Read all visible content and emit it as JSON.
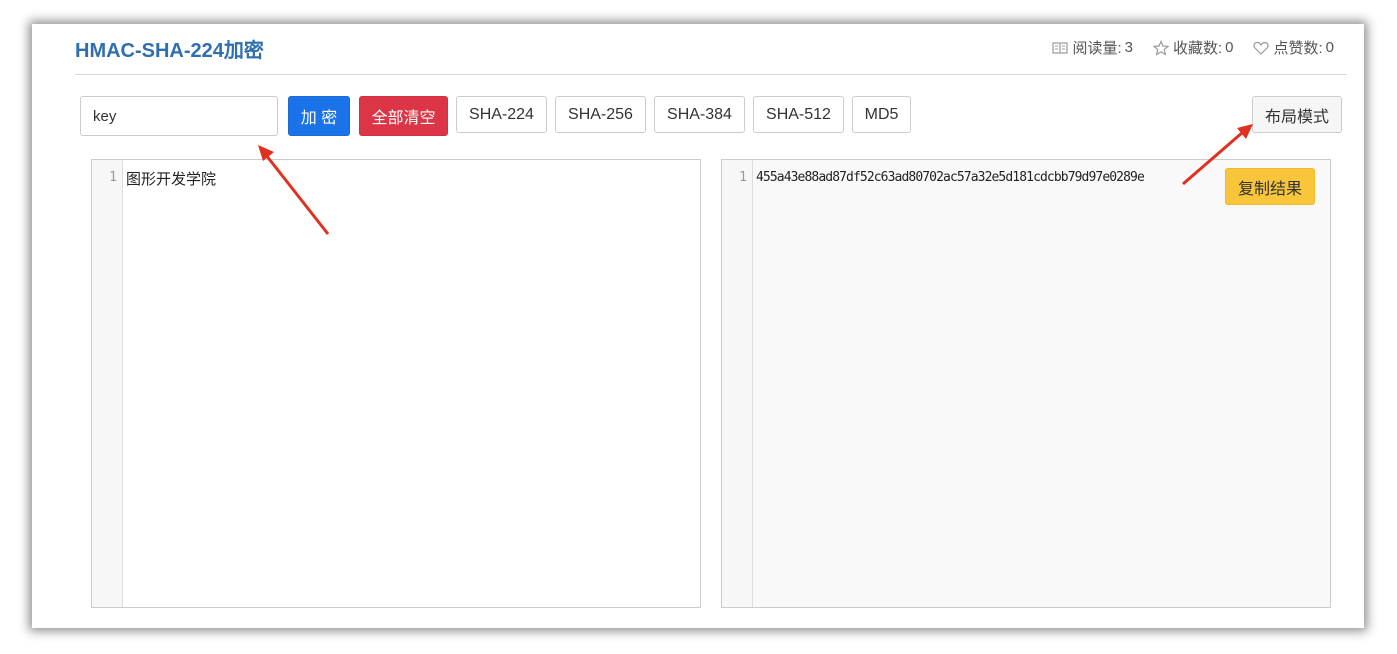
{
  "page": {
    "title": "HMAC-SHA-224加密",
    "stats": {
      "read_label": "阅读量:",
      "read_value": "3",
      "fav_label": "收藏数:",
      "fav_value": "0",
      "like_label": "点赞数:",
      "like_value": "0"
    }
  },
  "toolbar": {
    "key_value": "key",
    "encrypt_label": "加 密",
    "clear_label": "全部清空",
    "algorithms": [
      "SHA-224",
      "SHA-256",
      "SHA-384",
      "SHA-512",
      "MD5"
    ],
    "layout_label": "布局模式"
  },
  "input_editor": {
    "line_number": "1",
    "text": "图形开发学院"
  },
  "output_editor": {
    "line_number": "1",
    "text": "455a43e88ad87df52c63ad80702ac57a32e5d181cdcbb79d97e0289e",
    "copy_label": "复制结果"
  },
  "colors": {
    "title": "#2f6fb0",
    "primary": "#1a73e8",
    "danger": "#dc3545",
    "copy": "#f9c63b",
    "annotation_arrow": "#e0301e"
  },
  "icons": [
    "book-icon",
    "star-icon",
    "heart-icon"
  ]
}
